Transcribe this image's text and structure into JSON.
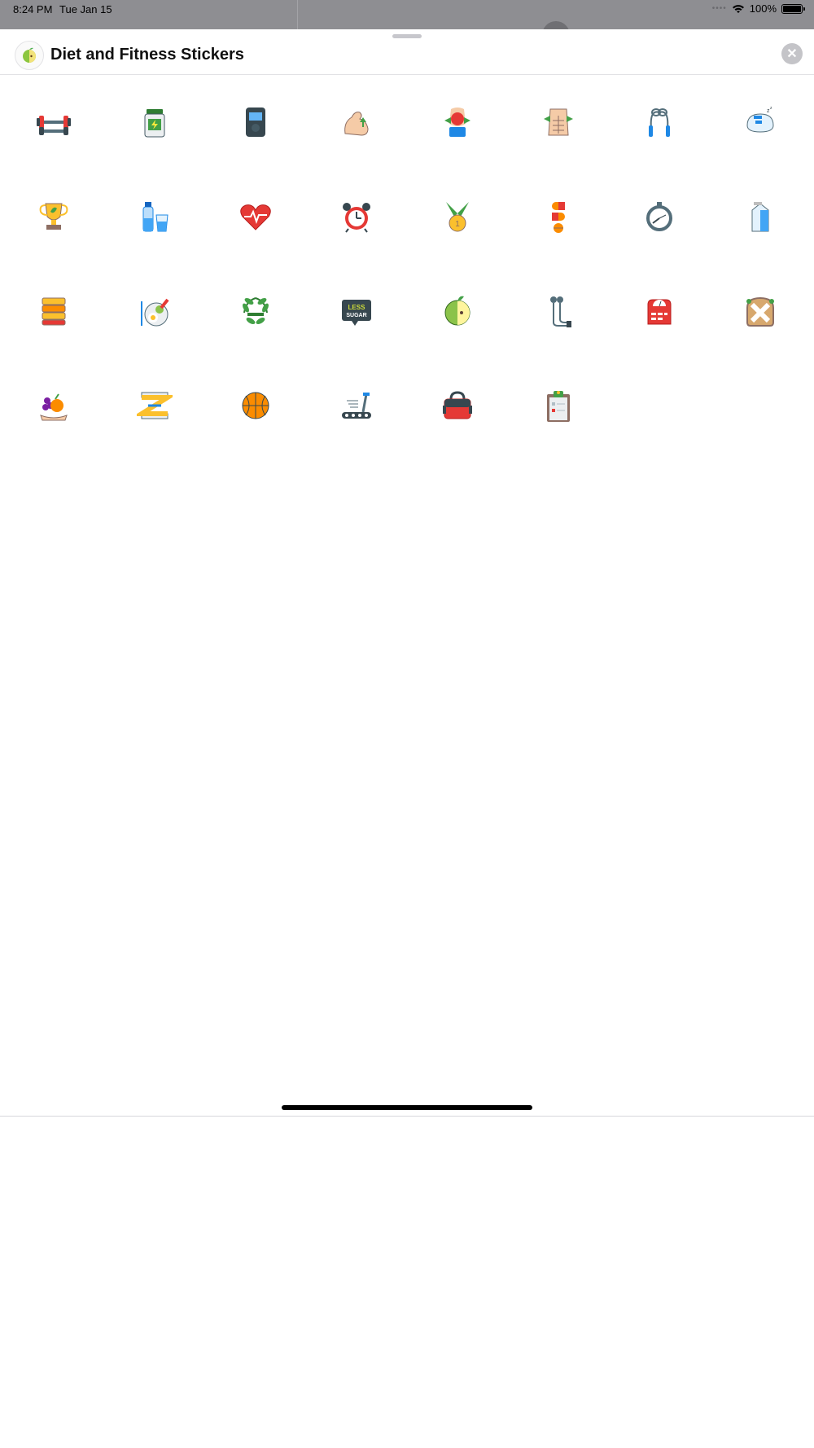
{
  "status_bar": {
    "time": "8:24 PM",
    "date": "Tue Jan 15",
    "battery": "100%"
  },
  "sheet": {
    "title": "Diet and Fitness Stickers",
    "close_icon": "close-icon"
  },
  "stickers": [
    {
      "name": "dumbbell",
      "icon": "dumbbell-icon"
    },
    {
      "name": "supplement-jar",
      "icon": "jar-icon"
    },
    {
      "name": "fitness-tracker",
      "icon": "tracker-icon"
    },
    {
      "name": "flexed-arm",
      "icon": "arm-icon"
    },
    {
      "name": "apple-waist",
      "icon": "apple-waist-icon"
    },
    {
      "name": "abs-torso",
      "icon": "torso-icon"
    },
    {
      "name": "jump-rope",
      "icon": "jump-rope-icon"
    },
    {
      "name": "sleep",
      "icon": "sleep-icon"
    },
    {
      "name": "trophy",
      "icon": "trophy-icon"
    },
    {
      "name": "water-bottle-glass",
      "icon": "water-icon"
    },
    {
      "name": "heartbeat",
      "icon": "heart-icon"
    },
    {
      "name": "alarm-clock",
      "icon": "alarm-icon"
    },
    {
      "name": "medal",
      "icon": "medal-icon"
    },
    {
      "name": "pills",
      "icon": "pills-icon"
    },
    {
      "name": "stopwatch",
      "icon": "stopwatch-icon"
    },
    {
      "name": "milk-carton",
      "icon": "milk-icon"
    },
    {
      "name": "sandwich",
      "icon": "sandwich-icon"
    },
    {
      "name": "healthy-plate",
      "icon": "plate-icon"
    },
    {
      "name": "leaf-wreath",
      "icon": "wreath-icon"
    },
    {
      "name": "less-sugar",
      "icon": "less-sugar-icon",
      "text": "LESS SUGAR"
    },
    {
      "name": "green-apple",
      "icon": "apple-icon"
    },
    {
      "name": "earphones",
      "icon": "earphones-icon"
    },
    {
      "name": "scale",
      "icon": "scale-icon"
    },
    {
      "name": "no-bread",
      "icon": "no-bread-icon"
    },
    {
      "name": "fruit-hand",
      "icon": "fruit-icon"
    },
    {
      "name": "measuring-tape",
      "icon": "tape-icon"
    },
    {
      "name": "basketball",
      "icon": "basketball-icon"
    },
    {
      "name": "treadmill",
      "icon": "treadmill-icon"
    },
    {
      "name": "gym-bag",
      "icon": "bag-icon"
    },
    {
      "name": "clipboard",
      "icon": "clipboard-icon"
    }
  ]
}
